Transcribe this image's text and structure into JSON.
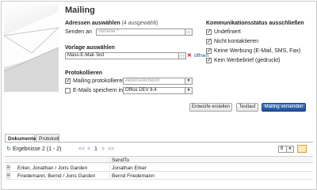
{
  "title": "Mailing",
  "addresses": {
    "heading": "Adressen auswählen",
    "count_note": "(4 ausgewählt)",
    "send_to_label": "Senden an",
    "send_to_placeholder": "Verteiler *"
  },
  "template": {
    "heading": "Vorlage auswählen",
    "value": "Mass-E-Mail-Test",
    "open_label": "öffnen"
  },
  "logging": {
    "heading": "Protokollieren",
    "log_mailing_label": "Mailing protokollieren",
    "log_mailing_checked": true,
    "log_mailing_value": "Aktionsstichwort",
    "save_emails_label": "E-Mails speichern in",
    "save_emails_checked": false,
    "save_emails_value": "Office DEV 8.4"
  },
  "comm_status": {
    "heading": "Kommunikationsstatus ausschließen",
    "options": [
      {
        "label": "Undefiniert",
        "checked": true
      },
      {
        "label": "Nicht kontaktieren",
        "checked": true
      },
      {
        "label": "Keine Werbung (E-Mail, SMS, Fax)",
        "checked": true
      },
      {
        "label": "Kein Werbebrief (gedruckt)",
        "checked": true
      }
    ]
  },
  "buttons": {
    "drafts": "Entwürfe erstellen",
    "test": "Testlauf",
    "send": "Mailing versenden"
  },
  "tabs": [
    "Dokumente",
    "Protokoll"
  ],
  "results": {
    "label": "Ergebnisse 2 (1 - 2)",
    "pager": {
      "first": "<<",
      "prev": "<",
      "page": "1",
      "next": ">",
      "last": ">>"
    },
    "page_size": "6"
  },
  "table": {
    "columns": [
      "",
      "SendTo"
    ],
    "rows": [
      {
        "name": "Erker, Jonathan / Jons Garden",
        "sendto": "Jonathan Erker"
      },
      {
        "name": "Friedemann, Bernd / Jons Garden",
        "sendto": "Bernd Friedemann"
      }
    ]
  }
}
